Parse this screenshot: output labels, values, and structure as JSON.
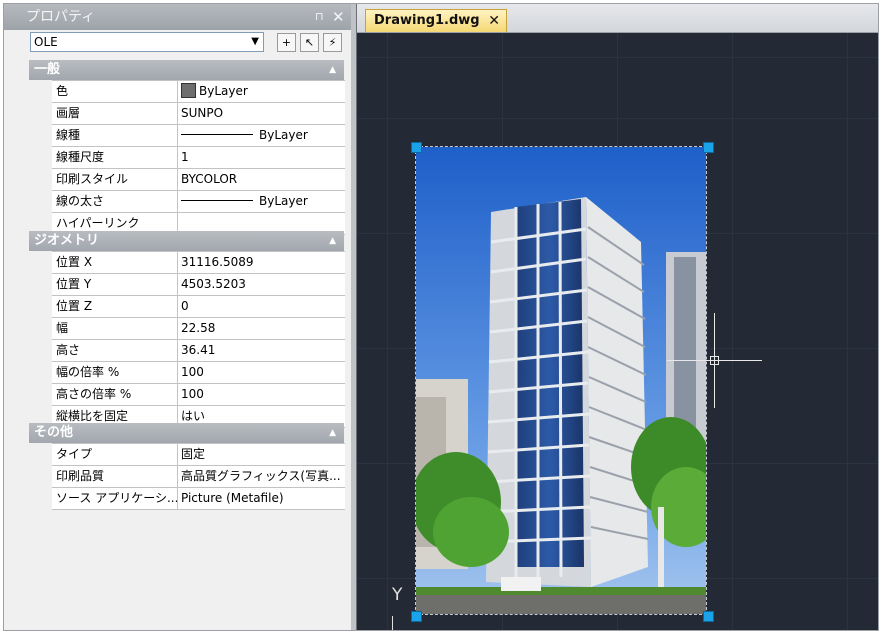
{
  "palette": {
    "title": "プロパティ",
    "pin_icon": "⊓",
    "close_icon": "✕",
    "selector": {
      "value": "OLE"
    },
    "toolbar": [
      {
        "icon": "toggle-pickadd-icon",
        "glyph": "+"
      },
      {
        "icon": "select-objects-icon",
        "glyph": "↖"
      },
      {
        "icon": "quick-select-icon",
        "glyph": "⚡"
      }
    ],
    "sections": [
      {
        "title": "一般",
        "rows": [
          {
            "label": "色",
            "value": "ByLayer",
            "swatch": true
          },
          {
            "label": "画層",
            "value": "SUNPO"
          },
          {
            "label": "線種",
            "value": "ByLayer",
            "line": true
          },
          {
            "label": "線種尺度",
            "value": "1"
          },
          {
            "label": "印刷スタイル",
            "value": "BYCOLOR"
          },
          {
            "label": "線の太さ",
            "value": "ByLayer",
            "line": true
          },
          {
            "label": "ハイパーリンク",
            "value": ""
          }
        ]
      },
      {
        "title": "ジオメトリ",
        "rows": [
          {
            "label": "位置 X",
            "value": "31116.5089"
          },
          {
            "label": "位置 Y",
            "value": "4503.5203"
          },
          {
            "label": "位置 Z",
            "value": "0"
          },
          {
            "label": "幅",
            "value": "22.58"
          },
          {
            "label": "高さ",
            "value": "36.41"
          },
          {
            "label": "幅の倍率 %",
            "value": "100"
          },
          {
            "label": "高さの倍率 %",
            "value": "100"
          },
          {
            "label": "縦横比を固定",
            "value": "はい"
          }
        ]
      },
      {
        "title": "その他",
        "rows": [
          {
            "label": "タイプ",
            "value": "固定"
          },
          {
            "label": "印刷品質",
            "value": "高品質グラフィックス(写真..."
          },
          {
            "label": "ソース アプリケーシ...",
            "value": "Picture (Metafile)"
          }
        ]
      }
    ],
    "collapse_glyph": "▲"
  },
  "document": {
    "tab_label": "Drawing1.dwg",
    "tab_close": "✕",
    "ucs_label": "Y"
  },
  "colors": {
    "canvas": "#232a36",
    "grip": "#1aa3e8",
    "tab_active": "#f5d873",
    "section_header": "#a2a7ad"
  }
}
